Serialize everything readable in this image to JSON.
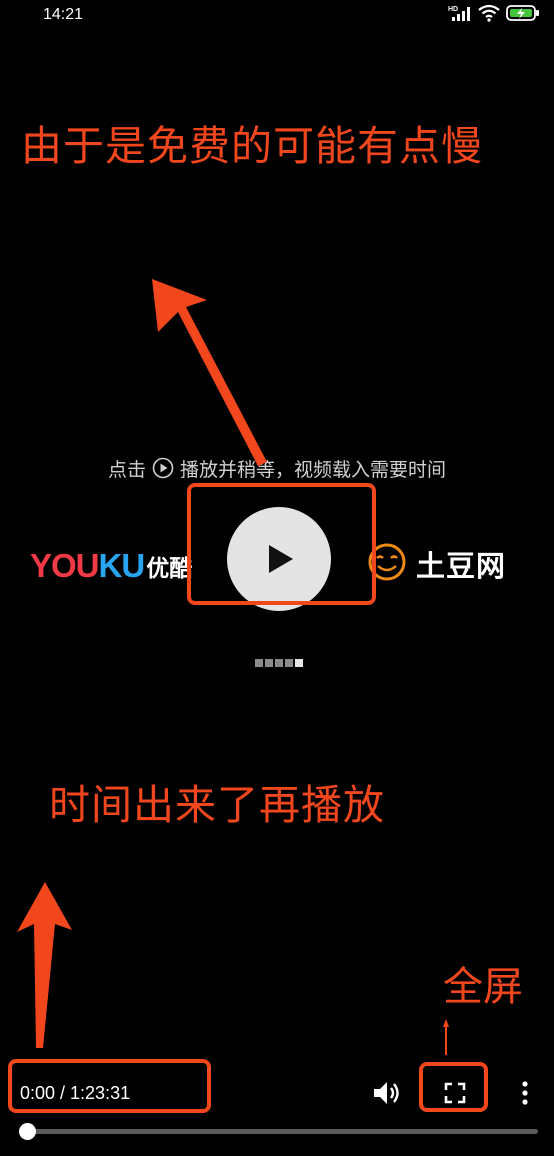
{
  "status_bar": {
    "time": "14:21",
    "hd_label": "HD",
    "icons": [
      "signal-icon",
      "wifi-icon",
      "battery-charging-icon"
    ]
  },
  "annotations": {
    "top_text": "由于是免费的可能有点慢",
    "middle_text": "时间出来了再播放",
    "fullscreen_text": "全屏",
    "color": "#f2471d"
  },
  "player": {
    "hint_prefix": "点击",
    "hint_suffix": "播放并稍等，视频载入需要时间",
    "logo_youku_text": "YOUKU",
    "logo_youku_cn": "优酷",
    "logo_tudou_cn": "土豆网",
    "time_display": "0:00 / 1:23:31",
    "progress": 0
  }
}
